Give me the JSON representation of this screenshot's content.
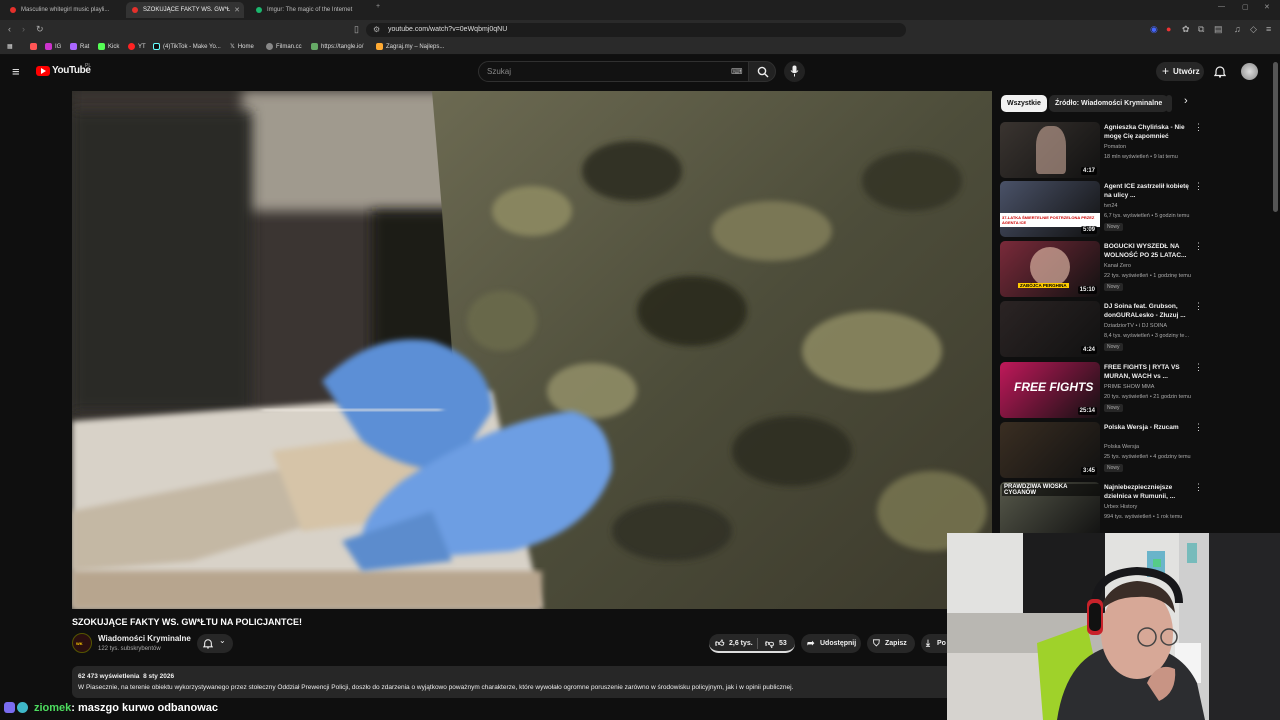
{
  "browser": {
    "tabs": [
      {
        "label": "Masculine whitegirl music playli...",
        "active": false,
        "fav_color": "#e5302b"
      },
      {
        "label": "SZOKUJĄCE FAKTY WS. GW*Ł",
        "active": true,
        "fav_color": "#e5302b"
      },
      {
        "label": "Imgur: The magic of the Internet",
        "active": false,
        "fav_color": "#1bb76e"
      }
    ],
    "url": "youtube.com/watch?v=0eWqbmj0qNU",
    "bookmarks": [
      "IG",
      "Rat",
      "Kick",
      "YT",
      "(4)TikTok - Make Yo...",
      "Home",
      "Filman.cc",
      "https://tangle.io/",
      "Zagraj.my – Najleps..."
    ]
  },
  "youtube": {
    "logo": "YouTube",
    "country": "PL",
    "search_placeholder": "Szukaj",
    "create_label": "Utwórz"
  },
  "video": {
    "title": "SZOKUJĄCE FAKTY WS. GW*ŁTU NA POLICJANTCE!",
    "channel": "Wiadomości Kryminalne",
    "subscribers": "122 tys. subskrybentów",
    "likes": "2,6 tys.",
    "dislikes": "53",
    "share_label": "Udostępnij",
    "save_label": "Zapisz",
    "download_label": "Po",
    "views": "62 473 wyświetlenia",
    "date": "8 sty 2026",
    "description": "W Piasecznie, na terenie obiektu wykorzystywanego przez stołeczny Oddział Prewencji Policji, doszło do zdarzenia o wyjątkowo poważnym charakterze, które wywołało ogromne poruszenie zarówno w środowisku policyjnym, jak i w opinii publicznej."
  },
  "sidebar": {
    "chips": [
      "Wszystkie",
      "Źródło: Wiadomości Kryminalne"
    ],
    "recommendations": [
      {
        "title": "Agnieszka Chylińska - Nie mogę Cię zapomnieć",
        "channel": "Pomaton",
        "meta": "18 mln wyświetleń • 9 lat temu",
        "duration": "4:17",
        "badge": "",
        "thumb": "#3a3430"
      },
      {
        "title": "Agent ICE zastrzelił kobietę na ulicy ...",
        "channel": "tvn24",
        "meta": "6,7 tys. wyświetleń • 5 godzin temu",
        "duration": "5:09",
        "badge": "Nowy",
        "thumb": "#4a5268"
      },
      {
        "title": "BOGUCKI WYSZEDŁ NA WOLNOŚĆ PO 25 LATAC...",
        "channel": "Kanał Zero",
        "meta": "22 tys. wyświetleń • 1 godzinę temu",
        "duration": "15:10",
        "badge": "Nowy",
        "thumb": "#7a2a3a"
      },
      {
        "title": "DJ Soina feat. Grubson, donGURALesko - Złuzuj ...",
        "channel": "DziadziorTV • i DJ SOINA",
        "meta": "8,4 tys. wyświetleń • 3 godziny te...",
        "duration": "4:24",
        "badge": "Nowy",
        "thumb": "#2b2424"
      },
      {
        "title": "FREE FIGHTS | RYTA VS MURAN, WACH vs ...",
        "channel": "PRIME SHOW MMA",
        "meta": "20 tys. wyświetleń • 21 godzin temu",
        "duration": "25:14",
        "badge": "Nowy",
        "thumb": "#c0185a"
      },
      {
        "title": "Polska Wersja - Rzucam",
        "channel": "Polska Wersja",
        "meta": "25 tys. wyświetleń • 4 godziny temu",
        "duration": "3:45",
        "badge": "Nowy",
        "thumb": "#3a2e22"
      },
      {
        "title": "Najniebezpieczniejsze dzielnica w Rumunii, ...",
        "channel": "Urbex History",
        "meta": "994 tys. wyświetleń • 1 rok temu",
        "duration": "",
        "badge": "",
        "thumb": "#56584a"
      }
    ]
  },
  "chat": {
    "user": "ziomek",
    "message": ": maszgo kurwo odbanowac",
    "user_color": "#4ddc5f"
  },
  "thumb_texts": {
    "rec2": "37-LATKA ŚMIERTELNIE POSTRZELONA PRZEZ AGENTA ICE",
    "rec3": "ZABÓJCA PERGHINA",
    "rec5": "FREE FIGHTS",
    "rec7": "PRAWDZIWA WIOSKA CYGANÓW"
  }
}
